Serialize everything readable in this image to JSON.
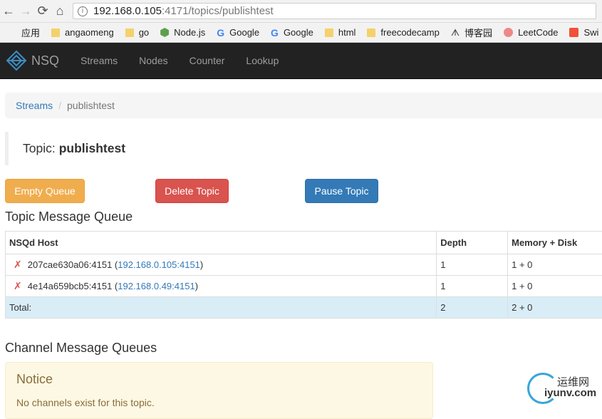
{
  "browser": {
    "back_icon": "←",
    "forward_icon": "→",
    "reload_icon": "⟳",
    "home_icon": "⌂",
    "url_host": "192.168.0.105",
    "url_rest": ":4171/topics/publishtest"
  },
  "bookmarks": [
    {
      "label": "应用",
      "icon": "apps-icon"
    },
    {
      "label": "angaomeng",
      "icon": "folder-icon"
    },
    {
      "label": "go",
      "icon": "folder-icon"
    },
    {
      "label": "Node.js",
      "icon": "nodejs-icon"
    },
    {
      "label": "Google",
      "icon": "google-icon"
    },
    {
      "label": "Google",
      "icon": "google-icon"
    },
    {
      "label": "html",
      "icon": "folder-icon"
    },
    {
      "label": "freecodecamp",
      "icon": "folder-icon"
    },
    {
      "label": "博客园",
      "icon": "cnblogs-icon"
    },
    {
      "label": "LeetCode",
      "icon": "leetcode-icon"
    },
    {
      "label": "Swi",
      "icon": "swift-icon"
    }
  ],
  "navbar": {
    "brand": "NSQ",
    "links": [
      "Streams",
      "Nodes",
      "Counter",
      "Lookup"
    ]
  },
  "breadcrumb": {
    "link": "Streams",
    "separator": "/",
    "active": "publishtest"
  },
  "topic": {
    "label": "Topic:",
    "name": "publishtest"
  },
  "buttons": {
    "empty": "Empty Queue",
    "delete": "Delete Topic",
    "pause": "Pause Topic"
  },
  "queue": {
    "title": "Topic Message Queue",
    "headers": [
      "NSQd Host",
      "Depth",
      "Memory + Disk"
    ],
    "rows": [
      {
        "status": "✗",
        "host": "207cae630a06:4151",
        "addr": "192.168.0.105:4151",
        "depth": "1",
        "mem": "1 + 0"
      },
      {
        "status": "✗",
        "host": "4e14a659bcb5:4151",
        "addr": "192.168.0.49:4151",
        "depth": "1",
        "mem": "1 + 0"
      }
    ],
    "total": {
      "label": "Total:",
      "depth": "2",
      "mem": "2 + 0"
    }
  },
  "channels": {
    "title": "Channel Message Queues",
    "notice_title": "Notice",
    "notice_msg": "No channels exist for this topic."
  },
  "watermark": {
    "cn": "运维网",
    "en": "iyunv.com"
  }
}
